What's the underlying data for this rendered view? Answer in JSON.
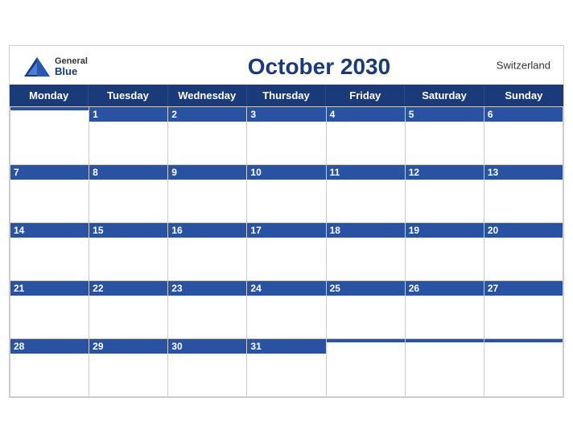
{
  "header": {
    "title": "October 2030",
    "country": "Switzerland",
    "logo_general": "General",
    "logo_blue": "Blue"
  },
  "days": [
    "Monday",
    "Tuesday",
    "Wednesday",
    "Thursday",
    "Friday",
    "Saturday",
    "Sunday"
  ],
  "weeks": [
    [
      null,
      1,
      2,
      3,
      4,
      5,
      6
    ],
    [
      7,
      8,
      9,
      10,
      11,
      12,
      13
    ],
    [
      14,
      15,
      16,
      17,
      18,
      19,
      20
    ],
    [
      21,
      22,
      23,
      24,
      25,
      26,
      27
    ],
    [
      28,
      29,
      30,
      31,
      null,
      null,
      null
    ]
  ]
}
